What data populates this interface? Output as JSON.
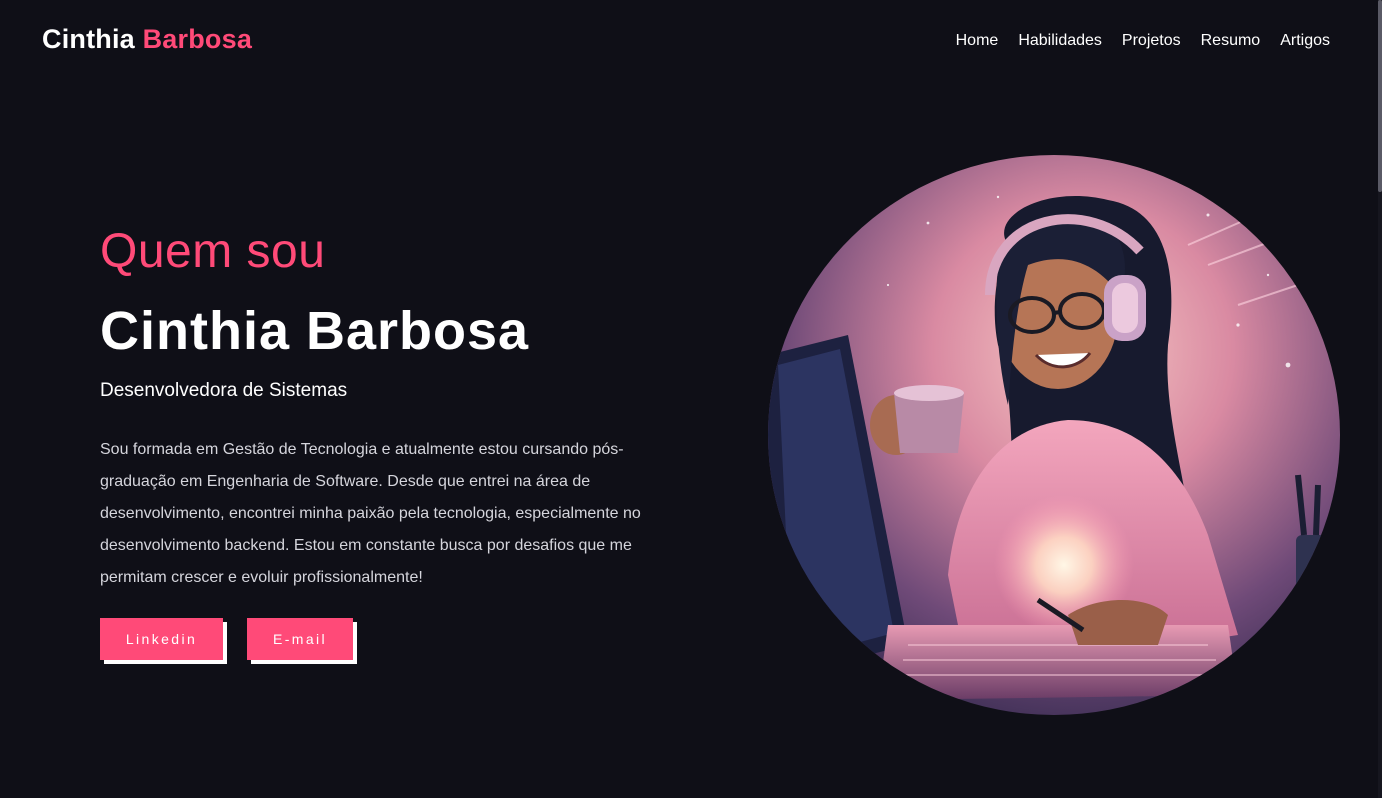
{
  "header": {
    "logo_first": "Cinthia",
    "logo_second": "Barbosa",
    "nav": [
      {
        "label": "Home"
      },
      {
        "label": "Habilidades"
      },
      {
        "label": "Projetos"
      },
      {
        "label": "Resumo"
      },
      {
        "label": "Artigos"
      }
    ]
  },
  "hero": {
    "eyebrow": "Quem sou",
    "name": "Cinthia Barbosa",
    "role": "Desenvolvedora de Sistemas",
    "bio": "Sou formada em Gestão de Tecnologia e atualmente estou cursando pós-graduação em Engenharia de Software. Desde que entrei na área de desenvolvimento, encontrei minha paixão pela tecnologia, especialmente no desenvolvimento backend. Estou em constante busca por desafios que me permitam crescer e evoluir profissionalmente!",
    "buttons": {
      "linkedin": "Linkedin",
      "email": "E-mail"
    },
    "portrait_alt": "illustration"
  },
  "colors": {
    "background": "#0f0f17",
    "accent": "#ff4a78",
    "text": "#ffffff",
    "muted_text": "#d5d5dc"
  }
}
